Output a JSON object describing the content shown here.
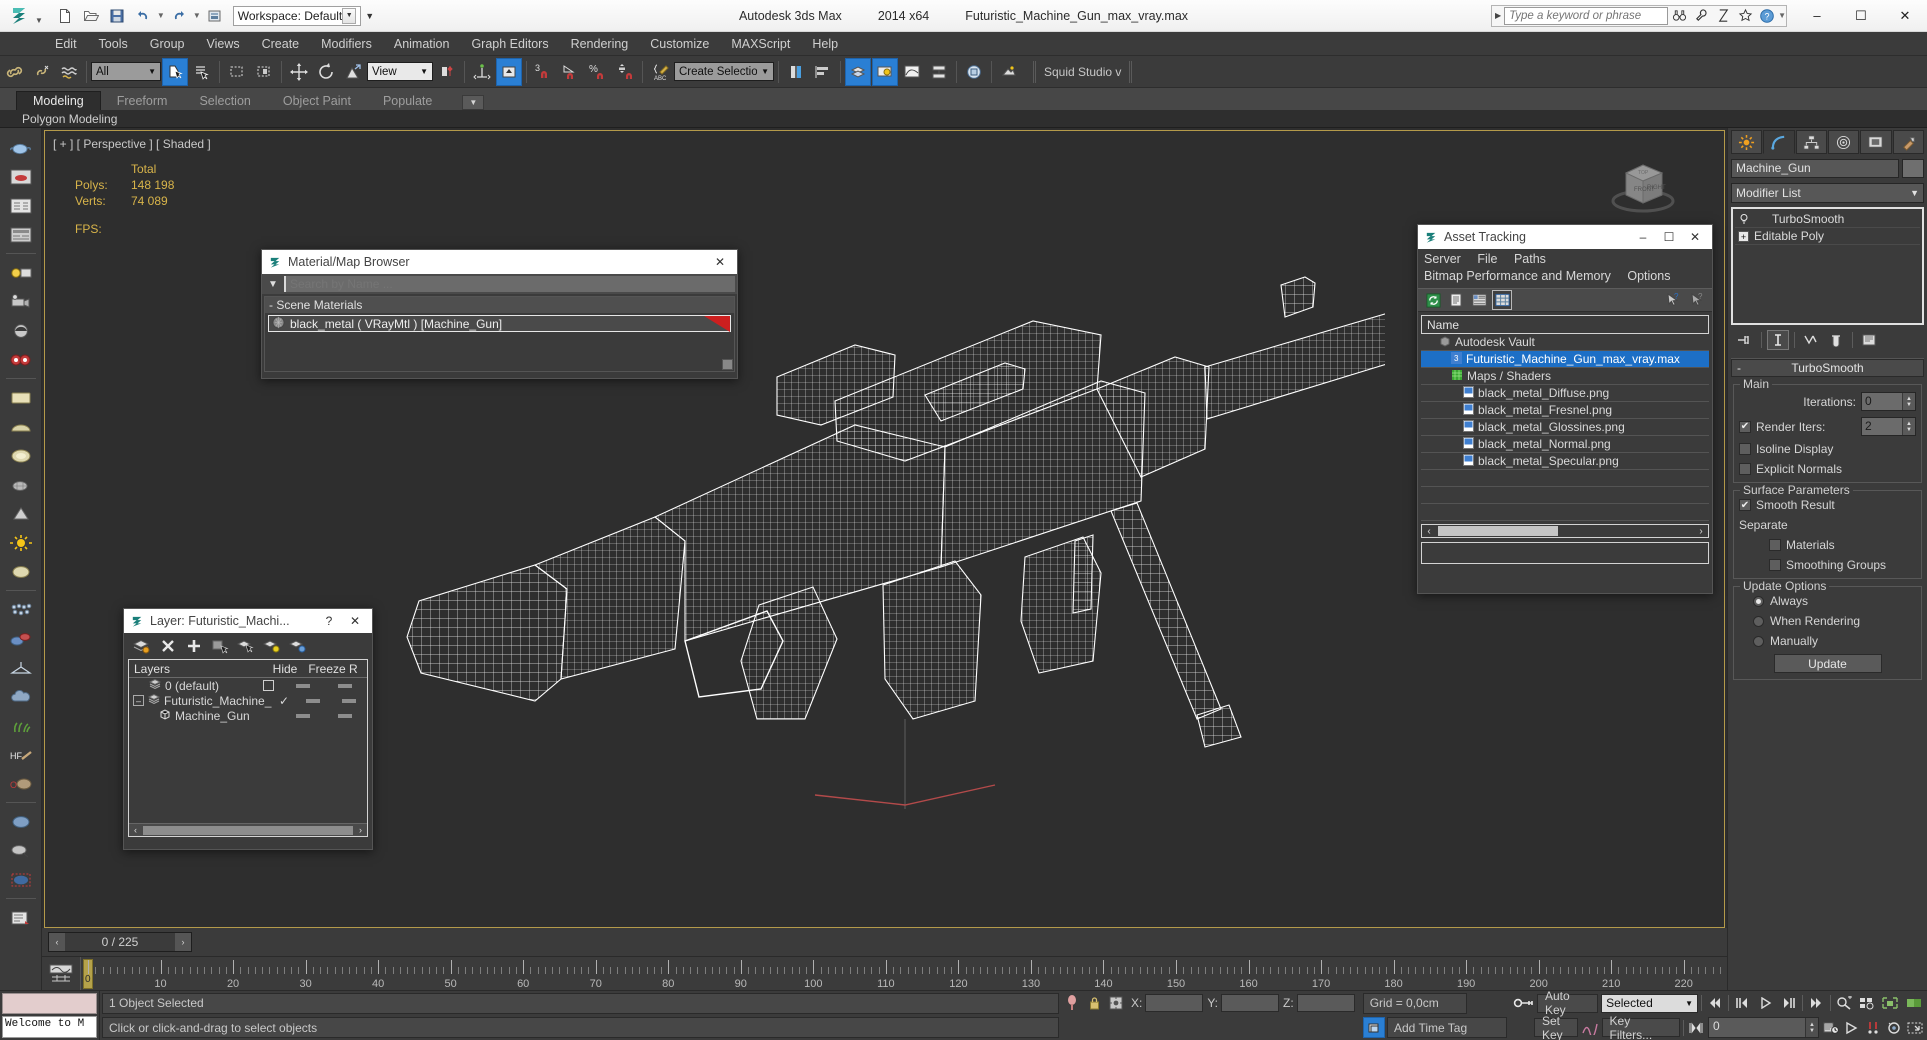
{
  "titlebar": {
    "workspace_label": "Workspace: Default",
    "app_name": "Autodesk 3ds Max",
    "version": "2014 x64",
    "document": "Futuristic_Machine_Gun_max_vray.max",
    "search_placeholder": "Type a keyword or phrase",
    "minimize": "–",
    "maximize": "☐",
    "close": "✕"
  },
  "menubar": {
    "items": [
      "Edit",
      "Tools",
      "Group",
      "Views",
      "Create",
      "Modifiers",
      "Animation",
      "Graph Editors",
      "Rendering",
      "Customize",
      "MAXScript",
      "Help"
    ]
  },
  "toolbar": {
    "selection_filter": "All",
    "reference_coord": "View",
    "selection_set": "Create Selection Se",
    "snap_percent_label": "%",
    "snap_count_label": "3",
    "plugin_label": "Squid Studio v"
  },
  "ribbon": {
    "tabs": [
      "Modeling",
      "Freeform",
      "Selection",
      "Object Paint",
      "Populate"
    ],
    "active_tab": "Modeling",
    "subtitle": "Polygon Modeling"
  },
  "viewport": {
    "label": "[ + ] [ Perspective ] [ Shaded ]",
    "stats": {
      "col_header": "Total",
      "polys_label": "Polys:",
      "polys_value": "148 198",
      "verts_label": "Verts:",
      "verts_value": "74 089",
      "fps_label": "FPS:",
      "fps_value": ""
    }
  },
  "material_browser": {
    "title": "Material/Map Browser",
    "search_placeholder": "Search by Name ...",
    "section": "- Scene Materials",
    "material": "black_metal  ( VRayMtl )  [Machine_Gun]",
    "close": "✕"
  },
  "asset_tracking": {
    "title": "Asset Tracking",
    "menus_row1": [
      "Server",
      "File",
      "Paths"
    ],
    "menus_row2": [
      "Bitmap Performance and Memory",
      "Options"
    ],
    "column_header": "Name",
    "rows": [
      {
        "label": "Autodesk Vault",
        "indent": 1,
        "icon": "vault-icon",
        "selected": false
      },
      {
        "label": "Futuristic_Machine_Gun_max_vray.max",
        "indent": 2,
        "icon": "max-file-icon",
        "selected": true
      },
      {
        "label": "Maps / Shaders",
        "indent": 2,
        "icon": "maps-icon",
        "selected": false
      },
      {
        "label": "black_metal_Diffuse.png",
        "indent": 3,
        "icon": "png-file-icon",
        "selected": false
      },
      {
        "label": "black_metal_Fresnel.png",
        "indent": 3,
        "icon": "png-file-icon",
        "selected": false
      },
      {
        "label": "black_metal_Glossines.png",
        "indent": 3,
        "icon": "png-file-icon",
        "selected": false
      },
      {
        "label": "black_metal_Normal.png",
        "indent": 3,
        "icon": "png-file-icon",
        "selected": false
      },
      {
        "label": "black_metal_Specular.png",
        "indent": 3,
        "icon": "png-file-icon",
        "selected": false
      }
    ],
    "minimize": "–",
    "maximize": "☐",
    "close": "✕"
  },
  "layer_dialog": {
    "title": "Layer: Futuristic_Machi...",
    "help": "?",
    "close": "✕",
    "columns": {
      "layers": "Layers",
      "hide": "Hide",
      "freeze": "Freeze",
      "render": "R"
    },
    "rows": [
      {
        "name": "0 (default)",
        "indent": 0,
        "icon": "layer-icon",
        "checkbox": "empty",
        "hide": "dash",
        "freeze": "dash"
      },
      {
        "name": "Futuristic_Machine_",
        "indent": 0,
        "icon": "layer-icon",
        "checkbox": "check",
        "hide": "dash",
        "freeze": "dash"
      },
      {
        "name": "Machine_Gun",
        "indent": 1,
        "icon": "object-icon",
        "checkbox": "none",
        "hide": "dash",
        "freeze": "dash"
      }
    ]
  },
  "command_panel": {
    "object_name": "Machine_Gun",
    "modifier_list_label": "Modifier List",
    "modifiers": [
      {
        "label": "TurboSmooth",
        "selected": true,
        "icon": "bulb-icon"
      },
      {
        "label": "Editable Poly",
        "selected": false,
        "icon": "plus-box-icon"
      }
    ],
    "rollout": {
      "title": "TurboSmooth",
      "collapse_marker": "-",
      "groups": [
        {
          "name": "Main",
          "iterations_label": "Iterations:",
          "iterations_value": "0",
          "render_iters_label": "Render Iters:",
          "render_iters_value": "2",
          "render_iters_checked": true,
          "isoline_label": "Isoline Display",
          "isoline_checked": false,
          "explicit_label": "Explicit Normals",
          "explicit_checked": false
        },
        {
          "name": "Surface Parameters",
          "smooth_result_label": "Smooth Result",
          "smooth_result_checked": true,
          "separate_label": "Separate",
          "materials_label": "Materials",
          "materials_checked": false,
          "smoothing_groups_label": "Smoothing Groups",
          "smoothing_groups_checked": false
        },
        {
          "name": "Update Options",
          "options": [
            "Always",
            "When Rendering",
            "Manually"
          ],
          "selected_option": "Always",
          "update_button": "Update"
        }
      ]
    }
  },
  "timeline": {
    "frame_display": "0 / 225",
    "prev": "‹",
    "next": "›",
    "ticks": [
      0,
      10,
      20,
      30,
      40,
      50,
      60,
      70,
      80,
      90,
      100,
      110,
      120,
      130,
      140,
      150,
      160,
      170,
      180,
      190,
      200,
      210,
      220
    ],
    "current_frame": 0,
    "max_frame": 225
  },
  "status_bar": {
    "listener_text": "Welcome to M",
    "selection_status": "1 Object Selected",
    "prompt": "Click or click-and-drag to select objects",
    "x_label": "X:",
    "x_value": "",
    "y_label": "Y:",
    "y_value": "",
    "z_label": "Z:",
    "z_value": "",
    "grid_label": "Grid = 0,0cm",
    "time_tag": "Add Time Tag",
    "auto_key": "Auto Key",
    "set_key": "Set Key",
    "key_mode": "Selected",
    "key_filters": "Key Filters...",
    "frame_field": "0"
  },
  "colors": {
    "accent_blue": "#2a7fd4",
    "selection_blue": "#1d6fc6",
    "panel_bg": "#3b3b3b",
    "viewport_bg": "#2e2e2e",
    "viewport_border": "#b49a4a",
    "stat_yellow": "#d8b44a",
    "red_flag": "#cc1f1f"
  }
}
